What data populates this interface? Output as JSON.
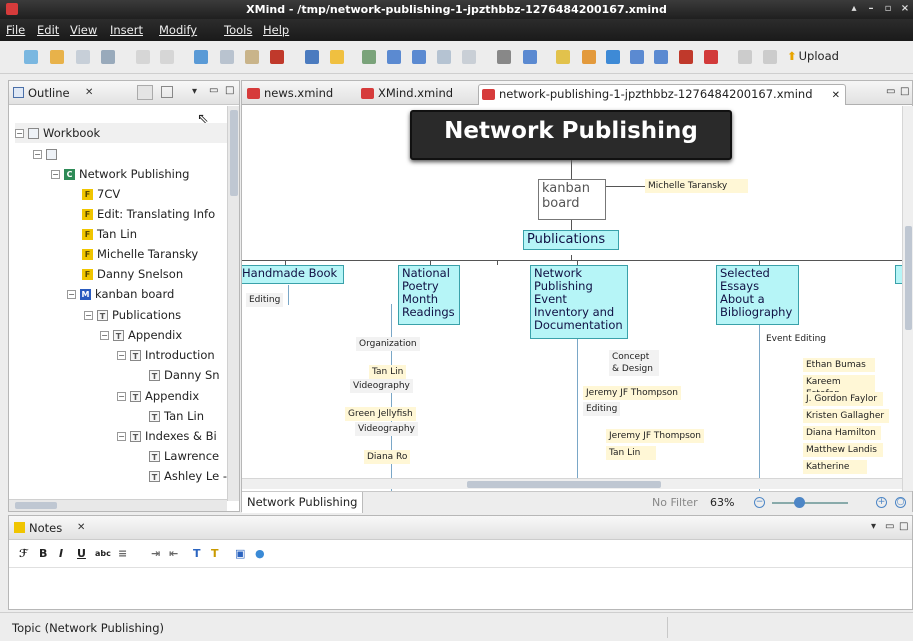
{
  "window": {
    "title": "XMind - /tmp/network-publishing-1-jpzthbbz-1276484200167.xmind"
  },
  "menubar": [
    "File",
    "Edit",
    "View",
    "Insert",
    "Modify",
    "Tools",
    "Help"
  ],
  "toolbar": {
    "upload_label": "Upload"
  },
  "outline": {
    "title": "Outline",
    "items": [
      {
        "label": "Workbook",
        "icon": "workbook-icon",
        "expand": "−"
      },
      {
        "label": "",
        "icon": "sheet-icon",
        "expand": "−"
      },
      {
        "label": "Network Publishing",
        "icon": "central-topic-icon",
        "expand": "−"
      },
      {
        "label": "7CV",
        "icon": "floating-topic-icon",
        "expand": ""
      },
      {
        "label": "Edit: Translating Info",
        "icon": "floating-topic-icon",
        "expand": ""
      },
      {
        "label": "Tan Lin",
        "icon": "floating-topic-icon",
        "expand": ""
      },
      {
        "label": "Michelle Taransky",
        "icon": "floating-topic-icon",
        "expand": ""
      },
      {
        "label": "Danny Snelson",
        "icon": "floating-topic-icon",
        "expand": ""
      },
      {
        "label": "kanban board",
        "icon": "main-topic-icon",
        "expand": "−"
      },
      {
        "label": "Publications",
        "icon": "topic-icon",
        "expand": "−"
      },
      {
        "label": "Appendix",
        "icon": "topic-icon",
        "expand": "−"
      },
      {
        "label": "Introduction",
        "icon": "topic-icon",
        "expand": "−"
      },
      {
        "label": "Danny Sn",
        "icon": "topic-icon",
        "expand": ""
      },
      {
        "label": "Appendix",
        "icon": "topic-icon",
        "expand": "−"
      },
      {
        "label": "Tan Lin",
        "icon": "topic-icon",
        "expand": ""
      },
      {
        "label": "Indexes & Bi",
        "icon": "topic-icon",
        "expand": "−"
      },
      {
        "label": "Lawrence",
        "icon": "topic-icon",
        "expand": ""
      },
      {
        "label": "Ashley Le -",
        "icon": "topic-icon",
        "expand": ""
      }
    ]
  },
  "tabs": [
    {
      "label": "news.xmind",
      "active": false
    },
    {
      "label": "XMind.xmind",
      "active": false
    },
    {
      "label": "network-publishing-1-jpzthbbz-1276484200167.xmind",
      "active": true
    }
  ],
  "mindmap": {
    "root": "Network Publishing",
    "kanban": "kanban board",
    "michelle": "Michelle Taransky",
    "publications": "Publications",
    "branches": [
      {
        "label": "Handmade Book"
      },
      {
        "label": "National Poetry Month Readings"
      },
      {
        "label": "Network Publishing Event Inventory and Documentation"
      },
      {
        "label": "Selected Essays About a Bibliography"
      }
    ],
    "labels": {
      "editing1": "Editing",
      "organization": "Organization",
      "tanlin1": "Tan Lin",
      "videography1": "Videography",
      "greenjellyfish": "Green Jellyfish",
      "videography2": "Videography",
      "dianaro": "Diana Ro",
      "concept": "Concept & Design",
      "jeremy1": "Jeremy JF Thompson",
      "editing2": "Editing",
      "jeremy2": "Jeremy JF Thompson",
      "tanlin2": "Tan Lin",
      "eventediting": "Event Editing",
      "ethan": "Ethan Bumas",
      "kareem": "Kareem Estefan",
      "gordon": "J. Gordon Faylor",
      "kristen": "Kristen Gallagher",
      "diana": "Diana Hamilton",
      "matthew": "Matthew Landis",
      "katherine": "Katherine"
    }
  },
  "editor_status": {
    "sheet": "Network Publishing",
    "filter": "No Filter",
    "zoom": "63%"
  },
  "notes": {
    "title": "Notes"
  },
  "status": {
    "text": "Topic (Network Publishing)"
  }
}
